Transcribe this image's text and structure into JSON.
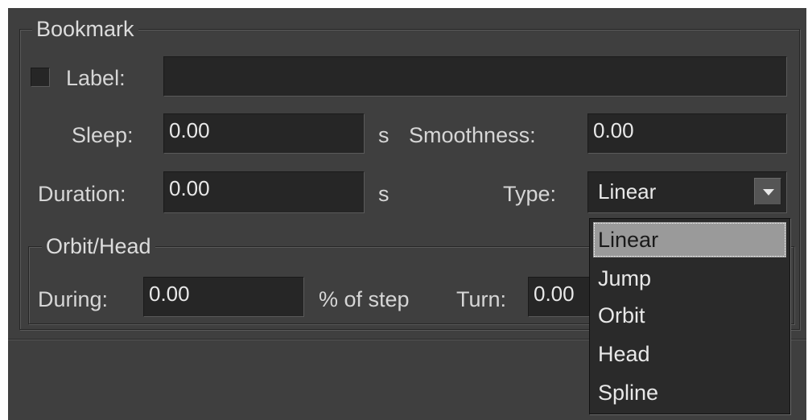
{
  "bookmark": {
    "group_title": "Bookmark",
    "label_label": "Label:",
    "label_value": "",
    "label_checked": false,
    "sleep_label": "Sleep:",
    "sleep_value": "0.00",
    "sleep_unit": "s",
    "smoothness_label": "Smoothness:",
    "smoothness_value": "0.00",
    "duration_label": "Duration:",
    "duration_value": "0.00",
    "duration_unit": "s",
    "type_label": "Type:",
    "type_value": "Linear"
  },
  "orbit_head": {
    "group_title": "Orbit/Head",
    "during_label": "During:",
    "during_value": "0.00",
    "during_unit": "% of step",
    "turn_label": "Turn:",
    "turn_value": "0.00"
  },
  "type_dropdown": {
    "open": true,
    "options": [
      "Linear",
      "Jump",
      "Orbit",
      "Head",
      "Spline"
    ],
    "selected_index": 0
  },
  "colors": {
    "panel_bg": "#3f3f3f",
    "field_bg": "#262626",
    "text": "#d6d6d6",
    "dropdown_highlight": "#9a9a9a"
  }
}
